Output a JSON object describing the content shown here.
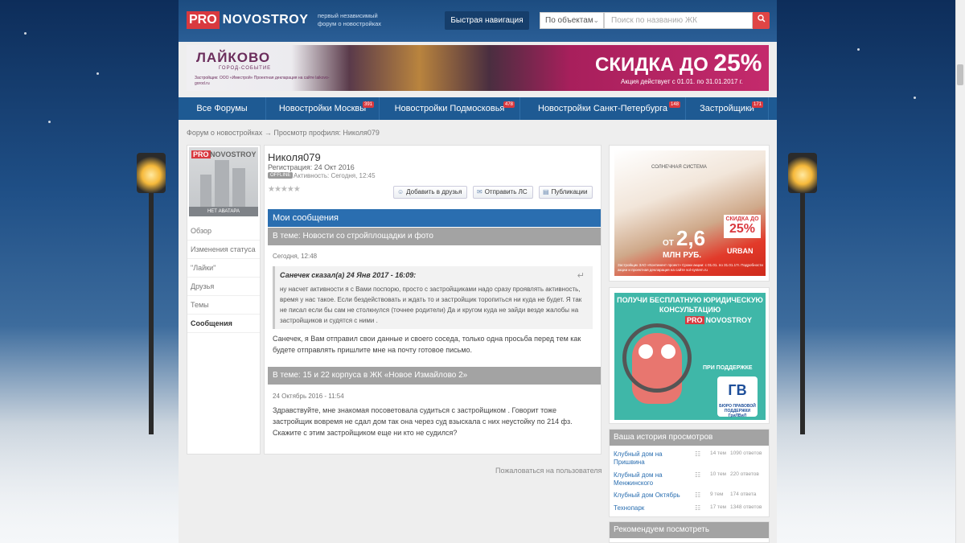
{
  "header": {
    "logo_pro": "PRO",
    "logo_name": "NOVOSTROY",
    "tagline": "первый независимый форум о новостройках",
    "quick_nav": "Быстрая навигация",
    "select_value": "По объектам",
    "search_placeholder": "Поиск по названию ЖК"
  },
  "banner": {
    "brand": "ЛАЙКОВО",
    "brand_sub": "ГОРОД-СОБЫТИЕ",
    "small": "Застройщик: ООО «Иместрой» Проектная декларация на сайте laikovo-gorod.ru",
    "discount_prefix": "СКИДКА ДО",
    "discount_value": "25%",
    "action": "Акция действует с 01.01. по 31.01.2017 г."
  },
  "nav": [
    {
      "label": "Все Форумы",
      "badge": ""
    },
    {
      "label": "Новостройки Москвы",
      "badge": "391"
    },
    {
      "label": "Новостройки Подмосковья",
      "badge": "478"
    },
    {
      "label": "Новостройки Санкт-Петербурга",
      "badge": "148"
    },
    {
      "label": "Застройщики",
      "badge": "171"
    }
  ],
  "breadcrumb": {
    "root": "Форум о новостройках",
    "sep": "→",
    "current": "Просмотр профиля: Николя079"
  },
  "sidebar": {
    "avatar_pro": "PRO",
    "avatar_name": "NOVOSTROY",
    "no_avatar": "НЕТ АВАТАРА",
    "items": [
      {
        "label": "Обзор"
      },
      {
        "label": "Изменения статуса"
      },
      {
        "label": "\"Лайки\""
      },
      {
        "label": "Друзья"
      },
      {
        "label": "Темы"
      },
      {
        "label": "Сообщения"
      }
    ]
  },
  "profile": {
    "name": "Николя079",
    "registration": "Регистрация: 24 Окт 2016",
    "status": "OFFLINE",
    "activity": "Активность: Сегодня, 12:45",
    "stars": "★★★★★",
    "btn_friend": "Добавить в друзья",
    "btn_pm": "Отправить ЛС",
    "btn_pubs": "Публикации",
    "messages_title": "Мои сообщения"
  },
  "posts": [
    {
      "topic": "В теме: Новости со стройплощадки и фото",
      "date": "Сегодня, 12:48",
      "quote_header": "Санечек сказал(а) 24 Янв 2017 - 16:09:",
      "quote_text": "ну насчет активности я с Вами поспорю, просто с застройщиками надо сразу проявлять активность, время у нас такое. Если бездействовать и ждать то и застройщик торопиться ни куда не будет. Я так не писал если бы сам не столкнулся  (точнее родители) Да и кругом куда не зайди везде жалобы на застройщиков и судятся с ними .",
      "text": "Санечек, я Вам отправил свои данные и своего соседа, только одна просьба перед тем как будете отправлять пришлите мне на почту готовое письмо."
    },
    {
      "topic": "В теме: 15 и 22 корпуса в ЖК «Новое Измайлово 2»",
      "date": "24 Октябрь 2016 - 11:54",
      "text": "Здравствуйте, мне знакомая посоветовала судиться с застройщиком . Говорит тоже застройщик вовремя не сдал дом так она через суд взыскала с них неустойку по 214 фз. Скажите с этим застройщиком еще ни кто не судился?"
    }
  ],
  "report": "Пожаловаться на пользователя",
  "ad1": {
    "system": "СОЛНЕЧНАЯ СИСТЕМА",
    "from": "ОТ",
    "price": "2,6",
    "mln": "МЛН РУБ.",
    "discount_label": "СКИДКА ДО",
    "discount_value": "25%",
    "urban": "URBAN",
    "fine": "Застройщик ЗАО «Континент проект» Сроки акции: с 01.01. по 31.01.17г. Подробности акции и проектная декларация на сайте sol-system.ru"
  },
  "ad2": {
    "title": "ПОЛУЧИ БЕСПЛАТНУЮ ЮРИДИЧЕСКУЮ КОНСУЛЬТАЦИЮ",
    "pro": "PRO",
    "name": "NOVOSTROY",
    "support": "ПРИ ПОДДЕРЖКЕ",
    "gv": "ГВ",
    "gv_sub": "БЮРО ПРАВОВОЙ ПОДДЕРЖКИ ГриЛВиЛ"
  },
  "history": {
    "title": "Ваша история просмотров",
    "items": [
      {
        "name": "Клубный дом на Пришвина",
        "topics": "14 тем",
        "answers": "1090 ответов"
      },
      {
        "name": "Клубный дом на Менжинского",
        "topics": "10 тем",
        "answers": "220 ответов"
      },
      {
        "name": "Клубный дом Октябрь",
        "topics": "9 тем",
        "answers": "174 ответа"
      },
      {
        "name": "Технопарк",
        "topics": "17 тем",
        "answers": "1348 ответов"
      }
    ]
  },
  "recommend": {
    "title": "Рекомендуем посмотреть"
  }
}
